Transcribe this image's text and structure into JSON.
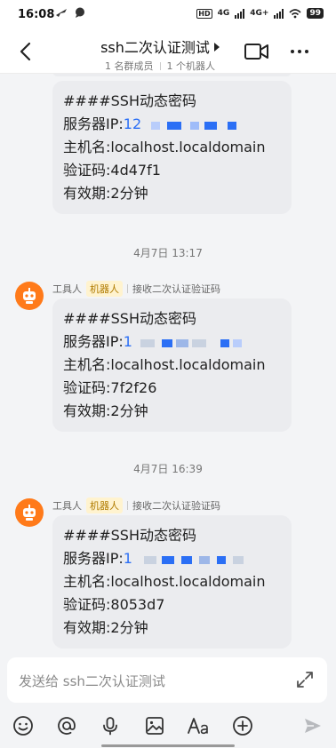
{
  "status_bar": {
    "time": "16:08",
    "net_1": "4G",
    "net_2": "4G+",
    "battery": "99"
  },
  "header": {
    "title": "ssh二次认证测试",
    "members": "1 名群成员",
    "robots": "1 个机器人"
  },
  "messages": [
    {
      "lines": [
        "####SSH动态密码",
        "服务器IP:",
        "主机名:localhost.localdomain",
        "验证码:4d47f1",
        "有效期:2分钟"
      ],
      "ip_prefix": "12"
    },
    {
      "timestamp": "4月7日 13:17",
      "sender": "工具人",
      "badge": "机器人",
      "subtitle": "接收二次认证验证码",
      "lines": [
        "####SSH动态密码",
        "服务器IP:",
        "主机名:localhost.localdomain",
        "验证码:7f2f26",
        "有效期:2分钟"
      ],
      "ip_prefix": "1"
    },
    {
      "timestamp": "4月7日 16:39",
      "sender": "工具人",
      "badge": "机器人",
      "subtitle": "接收二次认证验证码",
      "lines": [
        "####SSH动态密码",
        "服务器IP:",
        "主机名:localhost.localdomain",
        "验证码:8053d7",
        "有效期:2分钟"
      ],
      "ip_prefix": "1"
    }
  ],
  "composer": {
    "placeholder": "发送给 ssh二次认证测试"
  },
  "toolbar_icons": [
    "emoji-icon",
    "mention-icon",
    "microphone-icon",
    "image-icon",
    "text-format-icon",
    "add-icon",
    "send-icon"
  ],
  "colors": {
    "accent_blue": "#2b6ff5",
    "avatar_orange": "#ff7a1a",
    "badge_bg": "#fff3cf",
    "bubble_bg": "#ebecef"
  }
}
